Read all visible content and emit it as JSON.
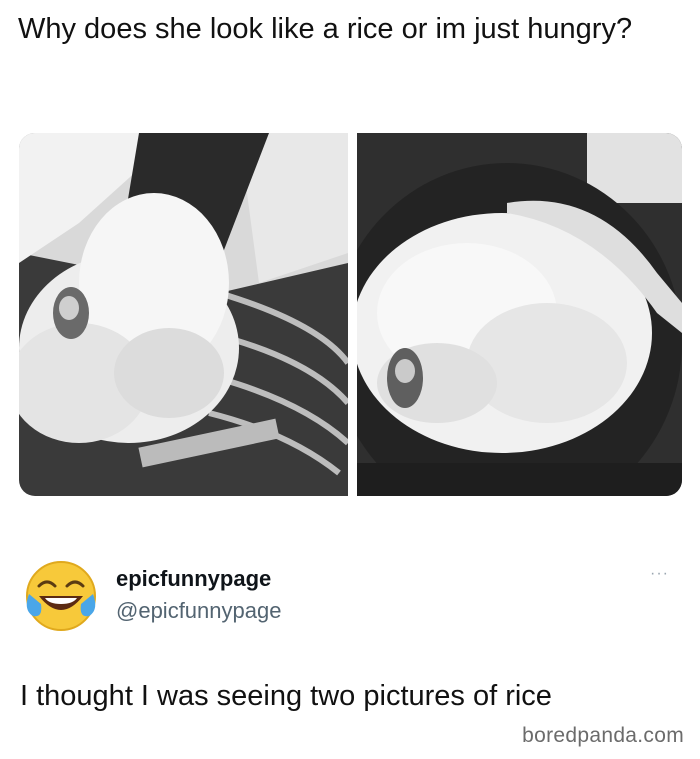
{
  "post": {
    "text": "Why does she look like a rice or im just hungry?"
  },
  "media": {
    "left_photo_icon": "rice-like-dress-photo",
    "right_photo_icon": "rice-pot-photo"
  },
  "reply": {
    "avatar_icon": "face-with-tears-of-joy-emoji",
    "display_name": "epicfunnypage",
    "handle": "@epicfunnypage",
    "more_icon": "more-options-icon",
    "more_label": "···",
    "text": "I thought I was seeing two pictures of rice"
  },
  "watermark": {
    "text": "boredpanda.com"
  }
}
